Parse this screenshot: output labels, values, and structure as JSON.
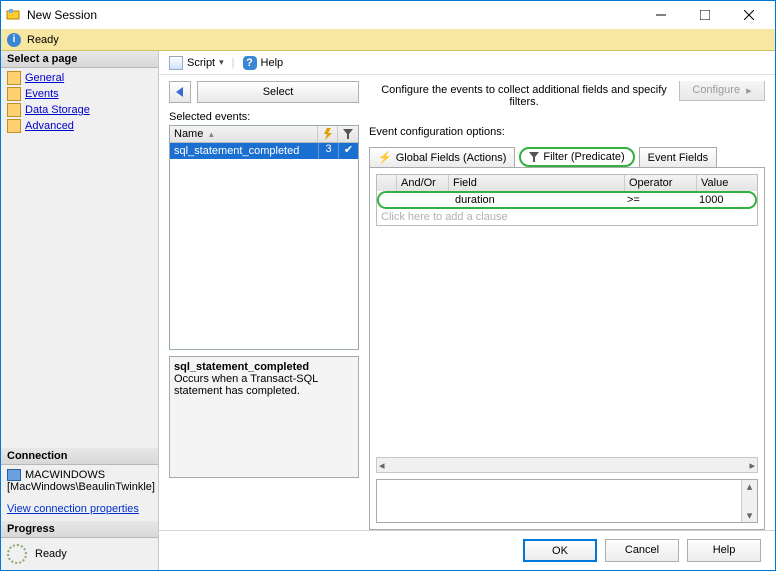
{
  "window": {
    "title": "New Session"
  },
  "status": {
    "text": "Ready"
  },
  "sidebar": {
    "heading": "Select a page",
    "items": [
      "General",
      "Events",
      "Data Storage",
      "Advanced"
    ]
  },
  "connection": {
    "heading": "Connection",
    "server": "MACWINDOWS",
    "user": "[MacWindows\\BeaulinTwinkle]",
    "link": "View connection properties"
  },
  "progress": {
    "heading": "Progress",
    "state": "Ready"
  },
  "toolbar": {
    "script": "Script",
    "help": "Help"
  },
  "nav": {
    "select_label": "Select"
  },
  "selected": {
    "label": "Selected events:",
    "header_name": "Name",
    "event": "sql_statement_completed",
    "count": "3"
  },
  "desc": {
    "title": "sql_statement_completed",
    "body": "Occurs when a Transact-SQL statement has completed."
  },
  "config": {
    "instruction": "Configure the events to collect additional fields and specify filters.",
    "button": "Configure",
    "label": "Event configuration options:",
    "tabs": {
      "global": "Global Fields (Actions)",
      "filter": "Filter (Predicate)",
      "fields": "Event Fields"
    },
    "pred": {
      "h_andor": "And/Or",
      "h_field": "Field",
      "h_op": "Operator",
      "h_val": "Value",
      "row": {
        "field": "duration",
        "op": ">=",
        "val": "1000"
      },
      "add": "Click here to add a clause"
    }
  },
  "buttons": {
    "ok": "OK",
    "cancel": "Cancel",
    "help": "Help"
  }
}
